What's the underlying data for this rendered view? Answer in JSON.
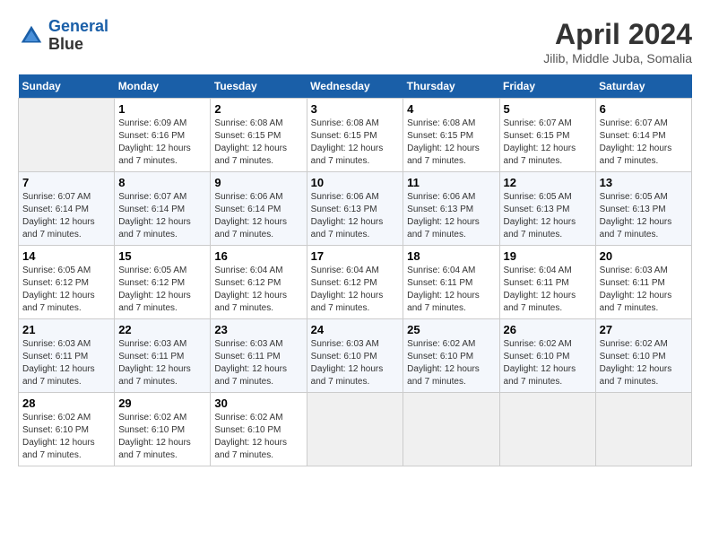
{
  "header": {
    "logo_line1": "General",
    "logo_line2": "Blue",
    "month": "April 2024",
    "location": "Jilib, Middle Juba, Somalia"
  },
  "days_of_week": [
    "Sunday",
    "Monday",
    "Tuesday",
    "Wednesday",
    "Thursday",
    "Friday",
    "Saturday"
  ],
  "weeks": [
    [
      {
        "day": "",
        "sunrise": "",
        "sunset": "",
        "daylight": ""
      },
      {
        "day": "1",
        "sunrise": "Sunrise: 6:09 AM",
        "sunset": "Sunset: 6:16 PM",
        "daylight": "Daylight: 12 hours and 7 minutes."
      },
      {
        "day": "2",
        "sunrise": "Sunrise: 6:08 AM",
        "sunset": "Sunset: 6:15 PM",
        "daylight": "Daylight: 12 hours and 7 minutes."
      },
      {
        "day": "3",
        "sunrise": "Sunrise: 6:08 AM",
        "sunset": "Sunset: 6:15 PM",
        "daylight": "Daylight: 12 hours and 7 minutes."
      },
      {
        "day": "4",
        "sunrise": "Sunrise: 6:08 AM",
        "sunset": "Sunset: 6:15 PM",
        "daylight": "Daylight: 12 hours and 7 minutes."
      },
      {
        "day": "5",
        "sunrise": "Sunrise: 6:07 AM",
        "sunset": "Sunset: 6:15 PM",
        "daylight": "Daylight: 12 hours and 7 minutes."
      },
      {
        "day": "6",
        "sunrise": "Sunrise: 6:07 AM",
        "sunset": "Sunset: 6:14 PM",
        "daylight": "Daylight: 12 hours and 7 minutes."
      }
    ],
    [
      {
        "day": "7",
        "sunrise": "Sunrise: 6:07 AM",
        "sunset": "Sunset: 6:14 PM",
        "daylight": "Daylight: 12 hours and 7 minutes."
      },
      {
        "day": "8",
        "sunrise": "Sunrise: 6:07 AM",
        "sunset": "Sunset: 6:14 PM",
        "daylight": "Daylight: 12 hours and 7 minutes."
      },
      {
        "day": "9",
        "sunrise": "Sunrise: 6:06 AM",
        "sunset": "Sunset: 6:14 PM",
        "daylight": "Daylight: 12 hours and 7 minutes."
      },
      {
        "day": "10",
        "sunrise": "Sunrise: 6:06 AM",
        "sunset": "Sunset: 6:13 PM",
        "daylight": "Daylight: 12 hours and 7 minutes."
      },
      {
        "day": "11",
        "sunrise": "Sunrise: 6:06 AM",
        "sunset": "Sunset: 6:13 PM",
        "daylight": "Daylight: 12 hours and 7 minutes."
      },
      {
        "day": "12",
        "sunrise": "Sunrise: 6:05 AM",
        "sunset": "Sunset: 6:13 PM",
        "daylight": "Daylight: 12 hours and 7 minutes."
      },
      {
        "day": "13",
        "sunrise": "Sunrise: 6:05 AM",
        "sunset": "Sunset: 6:13 PM",
        "daylight": "Daylight: 12 hours and 7 minutes."
      }
    ],
    [
      {
        "day": "14",
        "sunrise": "Sunrise: 6:05 AM",
        "sunset": "Sunset: 6:12 PM",
        "daylight": "Daylight: 12 hours and 7 minutes."
      },
      {
        "day": "15",
        "sunrise": "Sunrise: 6:05 AM",
        "sunset": "Sunset: 6:12 PM",
        "daylight": "Daylight: 12 hours and 7 minutes."
      },
      {
        "day": "16",
        "sunrise": "Sunrise: 6:04 AM",
        "sunset": "Sunset: 6:12 PM",
        "daylight": "Daylight: 12 hours and 7 minutes."
      },
      {
        "day": "17",
        "sunrise": "Sunrise: 6:04 AM",
        "sunset": "Sunset: 6:12 PM",
        "daylight": "Daylight: 12 hours and 7 minutes."
      },
      {
        "day": "18",
        "sunrise": "Sunrise: 6:04 AM",
        "sunset": "Sunset: 6:11 PM",
        "daylight": "Daylight: 12 hours and 7 minutes."
      },
      {
        "day": "19",
        "sunrise": "Sunrise: 6:04 AM",
        "sunset": "Sunset: 6:11 PM",
        "daylight": "Daylight: 12 hours and 7 minutes."
      },
      {
        "day": "20",
        "sunrise": "Sunrise: 6:03 AM",
        "sunset": "Sunset: 6:11 PM",
        "daylight": "Daylight: 12 hours and 7 minutes."
      }
    ],
    [
      {
        "day": "21",
        "sunrise": "Sunrise: 6:03 AM",
        "sunset": "Sunset: 6:11 PM",
        "daylight": "Daylight: 12 hours and 7 minutes."
      },
      {
        "day": "22",
        "sunrise": "Sunrise: 6:03 AM",
        "sunset": "Sunset: 6:11 PM",
        "daylight": "Daylight: 12 hours and 7 minutes."
      },
      {
        "day": "23",
        "sunrise": "Sunrise: 6:03 AM",
        "sunset": "Sunset: 6:11 PM",
        "daylight": "Daylight: 12 hours and 7 minutes."
      },
      {
        "day": "24",
        "sunrise": "Sunrise: 6:03 AM",
        "sunset": "Sunset: 6:10 PM",
        "daylight": "Daylight: 12 hours and 7 minutes."
      },
      {
        "day": "25",
        "sunrise": "Sunrise: 6:02 AM",
        "sunset": "Sunset: 6:10 PM",
        "daylight": "Daylight: 12 hours and 7 minutes."
      },
      {
        "day": "26",
        "sunrise": "Sunrise: 6:02 AM",
        "sunset": "Sunset: 6:10 PM",
        "daylight": "Daylight: 12 hours and 7 minutes."
      },
      {
        "day": "27",
        "sunrise": "Sunrise: 6:02 AM",
        "sunset": "Sunset: 6:10 PM",
        "daylight": "Daylight: 12 hours and 7 minutes."
      }
    ],
    [
      {
        "day": "28",
        "sunrise": "Sunrise: 6:02 AM",
        "sunset": "Sunset: 6:10 PM",
        "daylight": "Daylight: 12 hours and 7 minutes."
      },
      {
        "day": "29",
        "sunrise": "Sunrise: 6:02 AM",
        "sunset": "Sunset: 6:10 PM",
        "daylight": "Daylight: 12 hours and 7 minutes."
      },
      {
        "day": "30",
        "sunrise": "Sunrise: 6:02 AM",
        "sunset": "Sunset: 6:10 PM",
        "daylight": "Daylight: 12 hours and 7 minutes."
      },
      {
        "day": "",
        "sunrise": "",
        "sunset": "",
        "daylight": ""
      },
      {
        "day": "",
        "sunrise": "",
        "sunset": "",
        "daylight": ""
      },
      {
        "day": "",
        "sunrise": "",
        "sunset": "",
        "daylight": ""
      },
      {
        "day": "",
        "sunrise": "",
        "sunset": "",
        "daylight": ""
      }
    ]
  ]
}
